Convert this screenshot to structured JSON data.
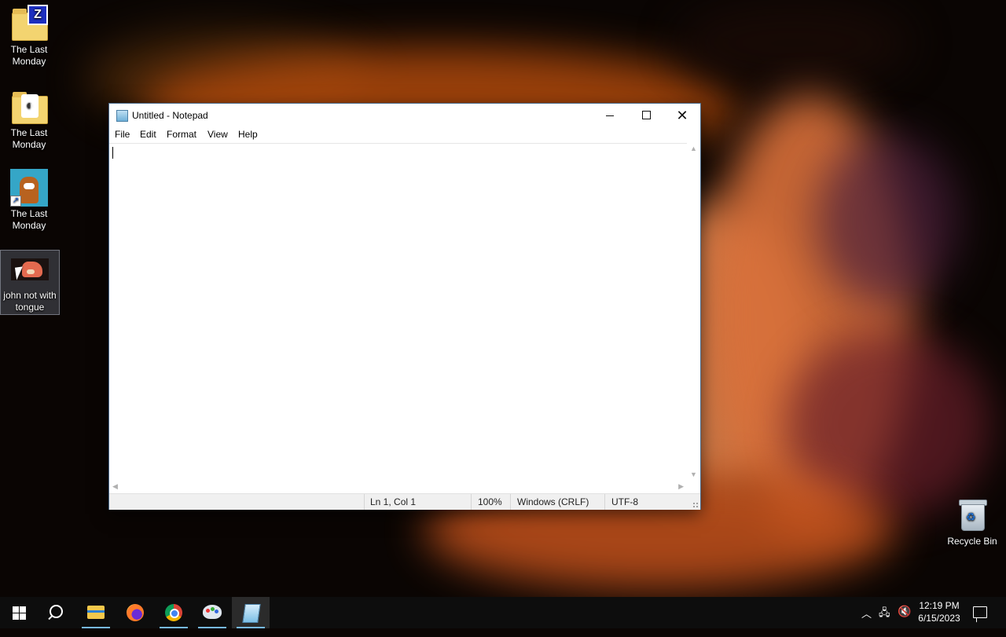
{
  "desktop": {
    "icons": [
      {
        "label": "The Last Monday",
        "icon": "zip-folder-icon"
      },
      {
        "label": "The Last Monday",
        "icon": "video-folder-icon"
      },
      {
        "label": "The Last Monday",
        "icon": "game-shortcut-icon"
      },
      {
        "label": "john not with tongue",
        "icon": "image-file-icon"
      }
    ],
    "recycle_bin": {
      "label": "Recycle Bin",
      "icon": "recycle-bin-icon"
    }
  },
  "notepad": {
    "title": "Untitled - Notepad",
    "menu": [
      "File",
      "Edit",
      "Format",
      "View",
      "Help"
    ],
    "content": "",
    "status": {
      "position": "Ln 1, Col 1",
      "zoom": "100%",
      "line_ending": "Windows (CRLF)",
      "encoding": "UTF-8"
    },
    "buttons": {
      "minimize": "minimize-icon",
      "maximize": "maximize-icon",
      "close": "close-icon"
    }
  },
  "taskbar": {
    "apps": [
      "start",
      "search",
      "file-explorer",
      "firefox",
      "chrome",
      "paint",
      "notepad"
    ],
    "active_app": "notepad",
    "clock_time": "12:19 PM",
    "clock_date": "6/15/2023"
  },
  "colors": {
    "taskbar_bg": "#0d0d0d",
    "accent": "#76b9ed",
    "window_border": "#4a6a8a"
  }
}
